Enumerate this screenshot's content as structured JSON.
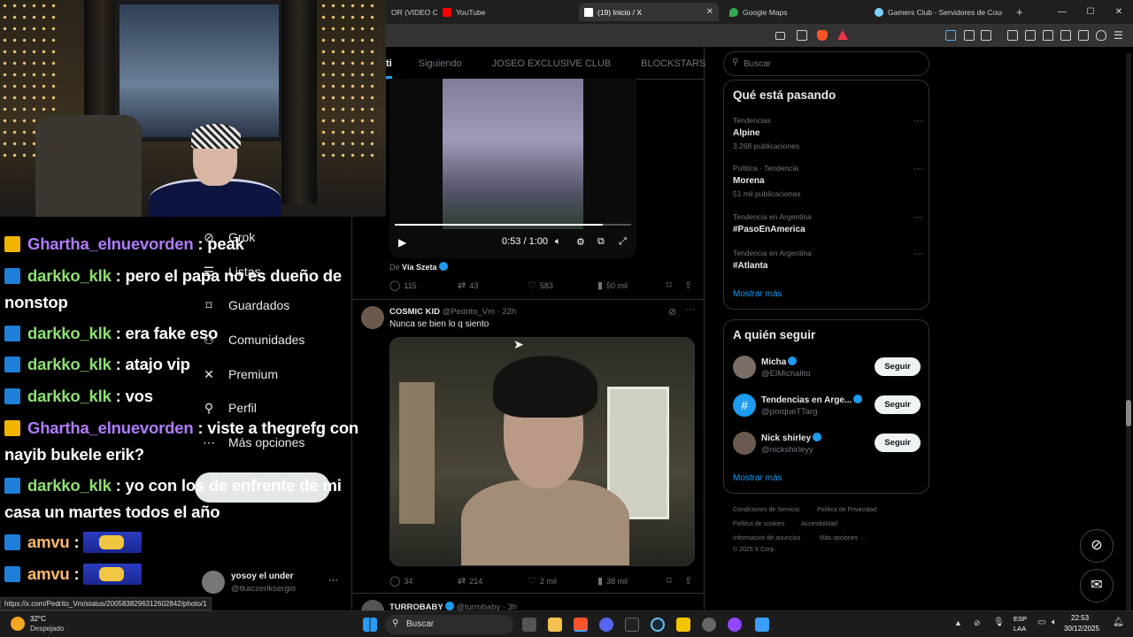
{
  "browser": {
    "tabs": [
      {
        "label": "OR (VIDEO C",
        "color": "#888888"
      },
      {
        "label": "YouTube",
        "color": "#ff0000"
      },
      {
        "label": "(19) Inicio / X",
        "color": "#ffffff"
      },
      {
        "label": "Google Maps",
        "color": "#34a853"
      },
      {
        "label": "Gamers Club - Servidores de Counte",
        "color": "#7dd3fc"
      }
    ],
    "new_tab": "+",
    "window_controls": [
      "—",
      "☐",
      "✕"
    ]
  },
  "stream_chat": [
    {
      "user": "Ghartha_elnuevorden",
      "badge": "gold",
      "color": "purple",
      "text": " : peak"
    },
    {
      "user": "darkko_klk",
      "badge": "blue",
      "color": "green",
      "text": " : pero el papa no es dueño de nonstop"
    },
    {
      "user": "darkko_klk",
      "badge": "blue",
      "color": "green",
      "text": " : era fake eso"
    },
    {
      "user": "darkko_klk",
      "badge": "blue",
      "color": "green",
      "text": " : atajo vip"
    },
    {
      "user": "darkko_klk",
      "badge": "blue",
      "color": "green",
      "text": " : vos"
    },
    {
      "user": "Ghartha_elnuevorden",
      "badge": "gold",
      "color": "purple",
      "text": " : viste a thegrefg con nayib bukele erik?"
    },
    {
      "user": "darkko_klk",
      "badge": "blue",
      "color": "green",
      "text": " : yo con los de enfrente de mi casa un martes todos el año"
    },
    {
      "user": "amvu",
      "badge": "blue",
      "color": "orange",
      "text": " : "
    },
    {
      "user": "amvu",
      "badge": "blue",
      "color": "orange",
      "text": " : "
    }
  ],
  "x_nav": [
    {
      "label": "Grok",
      "icon": "grok-icon",
      "glyph": "⊘"
    },
    {
      "label": "Listas",
      "icon": "list-icon",
      "glyph": "☰"
    },
    {
      "label": "Guardados",
      "icon": "bookmark-icon",
      "glyph": "⌑"
    },
    {
      "label": "Comunidades",
      "icon": "communities-icon",
      "glyph": "⚇"
    },
    {
      "label": "Premium",
      "icon": "x-logo-icon",
      "glyph": "✕"
    },
    {
      "label": "Perfil",
      "icon": "profile-icon",
      "glyph": "⚲"
    },
    {
      "label": "Más opciones",
      "icon": "more-options-icon",
      "glyph": "⋯"
    }
  ],
  "account": {
    "name": "yosoy el under",
    "handle": "@tkaczerlksergio"
  },
  "feed_tabs": [
    "ti",
    "Siguiendo",
    "JOSEO EXCLUSIVE CLUB",
    "BLOCKSTARS"
  ],
  "post1": {
    "video_time": "0:53 / 1:00",
    "video_progress": 0.88,
    "via_prefix": "De ",
    "via": "Vía Szeta",
    "replies": "115",
    "reposts": "43",
    "likes": "583",
    "views": "50 mil"
  },
  "post2": {
    "name": "COSMIC KID",
    "handle": "@Pedrito_Vm",
    "time": "· 22h",
    "text": "Nunca se bien lo q siento",
    "replies": "34",
    "reposts": "214",
    "likes": "2 mil",
    "views": "38 mil"
  },
  "post3": {
    "name": "TURROBABY",
    "handle": "@turrobaby",
    "time": "· 3h"
  },
  "search": {
    "placeholder": "Buscar"
  },
  "trending": {
    "title": "Qué está pasando",
    "items": [
      {
        "meta": "Tendencias",
        "name": "Alpine",
        "count": "3.268 publicaciones"
      },
      {
        "meta": "Política · Tendencia",
        "name": "Morena",
        "count": "51 mil publicaciones"
      },
      {
        "meta": "Tendencia en Argentina",
        "name": "#PasoEnAmerica",
        "count": ""
      },
      {
        "meta": "Tendencia en Argentina",
        "name": "#Atlanta",
        "count": ""
      }
    ],
    "show_more": "Mostrar más"
  },
  "who_to_follow": {
    "title": "A quién seguir",
    "items": [
      {
        "name": "Micha",
        "handle": "@ElMichalito",
        "button": "Seguir"
      },
      {
        "name": "Tendencias en Arge...",
        "handle": "@porqueTTarg",
        "button": "Seguir"
      },
      {
        "name": "Nick shirley",
        "handle": "@nickshirleyy",
        "button": "Seguir"
      }
    ],
    "show_more": "Mostrar más"
  },
  "footer": {
    "links": [
      "Condiciones de Servicio",
      "Política de Privacidad",
      "Política de cookies",
      "Accesibilidad",
      "Información de anuncios",
      "Más opciones ···"
    ],
    "copyright": "© 2025 X Corp."
  },
  "status_url": "https://x.com/Pedrito_Vm/status/2005838296312602842/photo/1",
  "taskbar": {
    "weather_temp": "32°C",
    "weather_desc": "Despejado",
    "search": "Buscar",
    "lang_top": "ESP",
    "lang_bottom": "LAA",
    "time": "22:53",
    "date": "30/12/2025"
  },
  "colors": {
    "accent": "#1d9bf0",
    "chat_green": "#8de070",
    "chat_purple": "#b07cff"
  }
}
